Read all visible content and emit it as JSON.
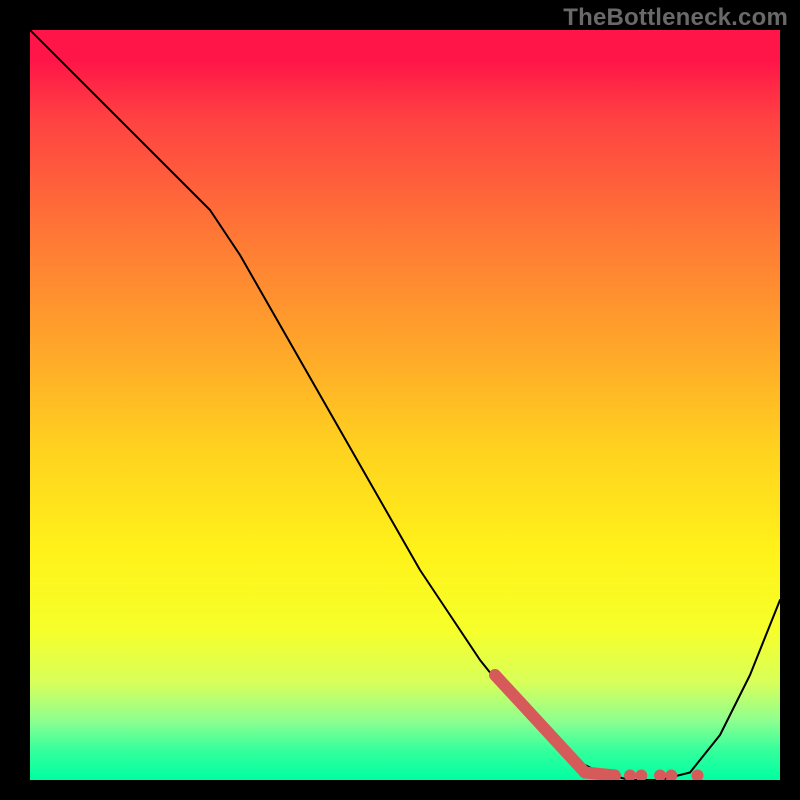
{
  "watermark": "TheBottleneck.com",
  "colors": {
    "background": "#000000",
    "gradient_top": "#ff1548",
    "gradient_mid1": "#ff7a35",
    "gradient_mid2": "#ffd21f",
    "gradient_mid3": "#fff31a",
    "gradient_bottom": "#00ffa2",
    "curve": "#000000",
    "highlight": "#d75a5a",
    "watermark_text": "#696969"
  },
  "chart_data": {
    "type": "line",
    "title": "",
    "xlabel": "",
    "ylabel": "",
    "xlim": [
      0,
      100
    ],
    "ylim": [
      0,
      100
    ],
    "grid": false,
    "series": [
      {
        "name": "bottleneck-curve",
        "x": [
          0,
          4,
          8,
          12,
          16,
          20,
          24,
          28,
          32,
          36,
          40,
          44,
          48,
          52,
          56,
          60,
          64,
          68,
          72,
          76,
          80,
          84,
          88,
          92,
          96,
          100
        ],
        "y": [
          100,
          96,
          92,
          88,
          84,
          80,
          76,
          70,
          63,
          56,
          49,
          42,
          35,
          28,
          22,
          16,
          11,
          7,
          3,
          1,
          0,
          0,
          1,
          6,
          14,
          24
        ]
      }
    ],
    "highlight": {
      "name": "selected-range",
      "segments": [
        {
          "kind": "line",
          "x": [
            62,
            74
          ],
          "y": [
            14,
            1
          ]
        },
        {
          "kind": "line",
          "x": [
            74,
            78
          ],
          "y": [
            1,
            0.6
          ]
        }
      ],
      "dots": [
        {
          "x": 80,
          "y": 0.6
        },
        {
          "x": 81.5,
          "y": 0.6
        },
        {
          "x": 84,
          "y": 0.6
        },
        {
          "x": 85.5,
          "y": 0.6
        },
        {
          "x": 89,
          "y": 0.6
        }
      ]
    },
    "legend": null,
    "annotations": []
  }
}
